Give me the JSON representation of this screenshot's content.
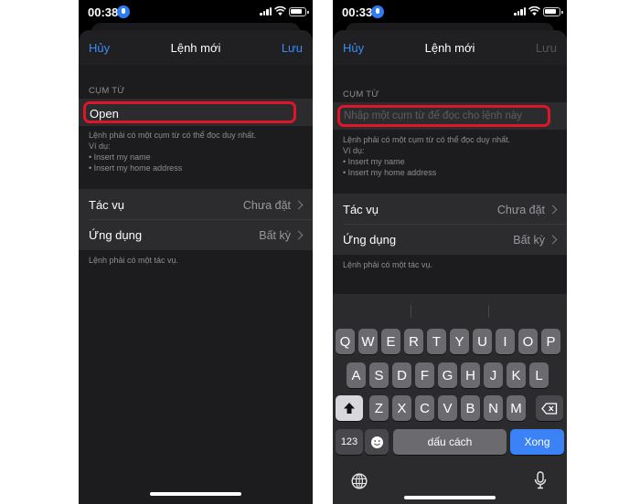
{
  "left": {
    "time": "00:38",
    "nav": {
      "cancel": "Hủy",
      "title": "Lệnh mới",
      "save": "Lưu"
    },
    "phrase_header": "CỤM TỪ",
    "phrase_value": "Open",
    "phrase_note": [
      "Lệnh phải có một cụm từ có thể đọc duy nhất.",
      "Ví dụ:",
      "• Insert my name",
      "• Insert my home address"
    ],
    "action_label": "Tác vụ",
    "action_value": "Chưa đặt",
    "app_label": "Ứng dụng",
    "app_value": "Bất kỳ",
    "action_note": "Lệnh phải có một tác vụ."
  },
  "right": {
    "time": "00:33",
    "nav": {
      "cancel": "Hủy",
      "title": "Lệnh mới",
      "save": "Lưu"
    },
    "phrase_header": "CỤM TỪ",
    "phrase_placeholder": "Nhập một cụm từ để đọc cho lệnh này",
    "phrase_note": [
      "Lệnh phải có một cụm từ có thể đọc duy nhất.",
      "Ví dụ:",
      "• Insert my name",
      "• Insert my home address"
    ],
    "action_label": "Tác vụ",
    "action_value": "Chưa đặt",
    "app_label": "Ứng dụng",
    "app_value": "Bất kỳ",
    "action_note": "Lệnh phải có một tác vụ.",
    "keyboard": {
      "row1": [
        "Q",
        "W",
        "E",
        "R",
        "T",
        "Y",
        "U",
        "I",
        "O",
        "P"
      ],
      "row2": [
        "A",
        "S",
        "D",
        "F",
        "G",
        "H",
        "J",
        "K",
        "L"
      ],
      "row3": [
        "Z",
        "X",
        "C",
        "V",
        "B",
        "N",
        "M"
      ],
      "numbers_key": "123",
      "space_key": "dấu cách",
      "done_key": "Xong"
    }
  },
  "icons": {
    "mic": "mic-icon",
    "signal": "cellular-signal-icon",
    "wifi": "wifi-icon",
    "battery": "battery-icon",
    "chevron": "chevron-right-icon",
    "shift": "shift-arrow-icon",
    "backspace": "delete-backspace-icon",
    "emoji": "emoji-face-icon",
    "globe": "globe-icon",
    "dictation": "dictation-mic-icon"
  },
  "colors": {
    "accent": "#3b8bf7",
    "highlight": "#e0152a",
    "done_key": "#3b82f6"
  }
}
